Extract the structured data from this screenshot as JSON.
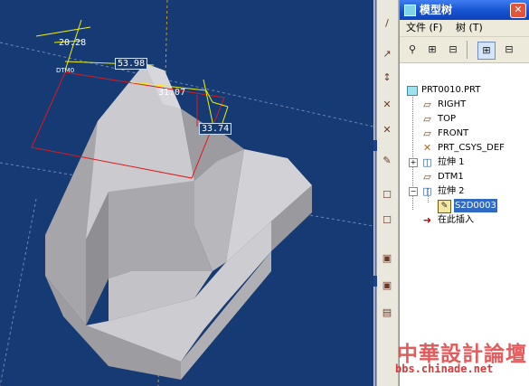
{
  "viewport": {
    "dimensions": {
      "d1": "20.28",
      "d2": "53.98",
      "d3": "31.07",
      "d4": "33.74"
    },
    "colors": {
      "background": "#163a73",
      "dimension_line": "#f5f000",
      "sketch_plane": "#e01818",
      "part_body": "#cfcfd2"
    }
  },
  "icon_strip": {
    "icons": [
      "sketch-pencil-icon",
      "dim-icon",
      "close-x-icon",
      "close-x-icon",
      "edit-icon",
      "wave-icon",
      "checkbox-icon",
      "checkbox-icon",
      "pan-icon",
      "slash-icon",
      "datum-icon",
      "layer-icon",
      "view-icon",
      "view-icon"
    ]
  },
  "model_tree": {
    "title": "模型树",
    "menu": {
      "file": "文件 (F)",
      "tree": "树 (T)"
    },
    "toolbar": {
      "icons": [
        "binoculars-icon",
        "tree-expand-icon",
        "tree-columns-icon",
        "tree-filter-icon",
        "tree-settings-icon"
      ]
    },
    "items": [
      {
        "label": "PRT0010.PRT",
        "icon": "part-icon"
      },
      {
        "label": "RIGHT",
        "icon": "datum-plane-icon"
      },
      {
        "label": "TOP",
        "icon": "datum-plane-icon"
      },
      {
        "label": "FRONT",
        "icon": "datum-plane-icon"
      },
      {
        "label": "PRT_CSYS_DEF",
        "icon": "csys-icon"
      },
      {
        "label": "拉伸 1",
        "icon": "extrude-icon"
      },
      {
        "label": "DTM1",
        "icon": "datum-plane-icon"
      },
      {
        "label": "拉伸 2",
        "icon": "extrude-icon"
      },
      {
        "label": "S2D0003",
        "icon": "sketch-icon"
      },
      {
        "label": "在此插入",
        "icon": "insert-here-icon"
      }
    ]
  },
  "watermark": {
    "title": "中華設計論壇",
    "url": "bbs.chinade.net"
  }
}
